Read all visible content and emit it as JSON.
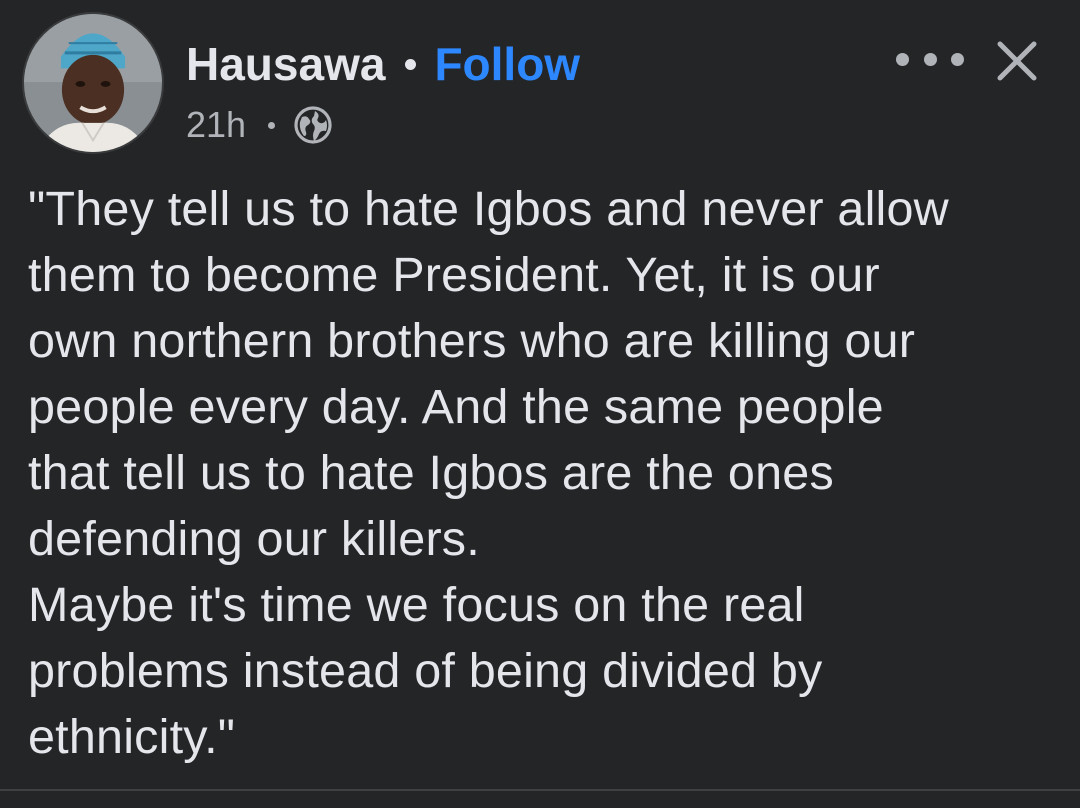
{
  "post": {
    "author": "Hausawa",
    "follow_label": "Follow",
    "time": "21h",
    "audience_icon": "globe-icon",
    "more_icon": "more-horizontal-icon",
    "close_icon": "close-icon",
    "text_lines": [
      "\"They tell us to hate Igbos and never allow",
      "them to become President. Yet, it is our",
      "own northern brothers who are killing our",
      "people every day. And the same people",
      "that tell us to hate Igbos are the ones",
      "defending our killers.",
      "Maybe it's time we focus on the real",
      "problems instead of being divided by",
      "ethnicity.\""
    ]
  },
  "colors": {
    "background": "#242527",
    "primary_text": "#e4e6eb",
    "secondary_text": "#b0b3b8",
    "follow_blue": "#2d88ff"
  }
}
